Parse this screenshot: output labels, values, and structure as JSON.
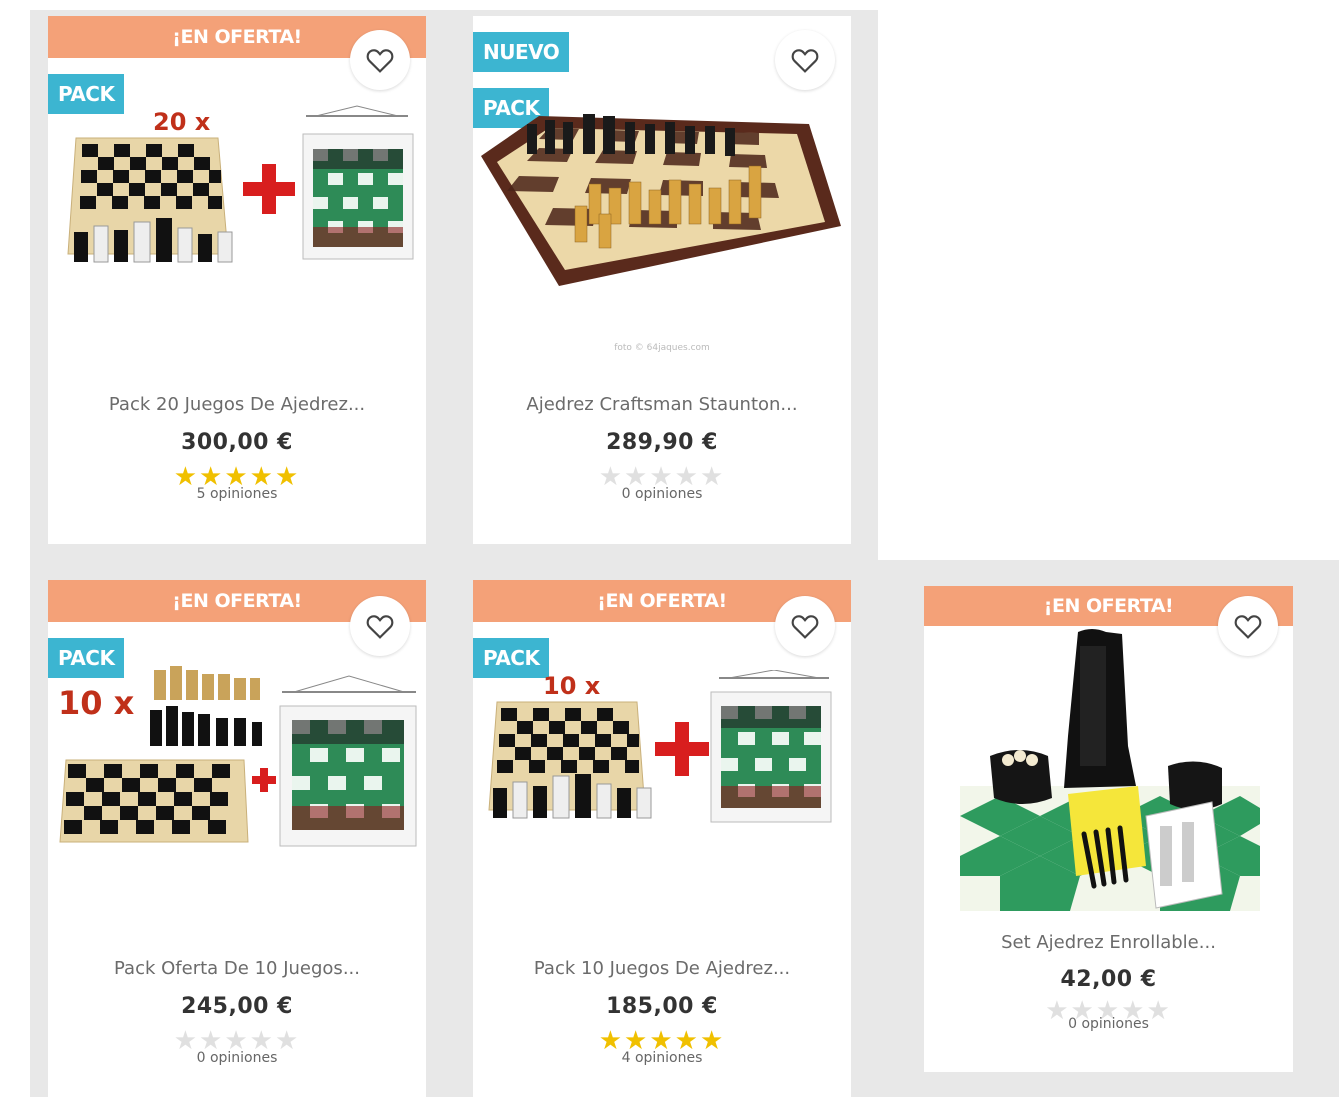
{
  "products": [
    {
      "offer_label": "¡EN OFERTA!",
      "flags": [
        "PACK"
      ],
      "name": "Pack 20 Juegos De Ajedrez...",
      "price": "300,00 €",
      "rating": 5,
      "reviews": "5 opiniones",
      "image_text": "20 x"
    },
    {
      "offer_label": "",
      "flags": [
        "NUEVO",
        "PACK"
      ],
      "name": "Ajedrez Craftsman Staunton...",
      "price": "289,90 €",
      "rating": 0,
      "reviews": "0 opiniones",
      "image_text": "foto © 64jaques.com"
    },
    {
      "offer_label": "¡EN OFERTA!",
      "flags": [
        "PACK"
      ],
      "name": "Pack Oferta De 10 Juegos...",
      "price": "245,00 €",
      "rating": 0,
      "reviews": "0 opiniones",
      "image_text": "10 x"
    },
    {
      "offer_label": "¡EN OFERTA!",
      "flags": [
        "PACK"
      ],
      "name": "Pack 10 Juegos De Ajedrez...",
      "price": "185,00 €",
      "rating": 5,
      "reviews": "4 opiniones",
      "image_text": "10 x"
    },
    {
      "offer_label": "¡EN OFERTA!",
      "flags": [],
      "name": "Set Ajedrez Enrollable...",
      "price": "42,00 €",
      "rating": 0,
      "reviews": "0 opiniones",
      "image_text": ""
    }
  ],
  "icons": {
    "wishlist": "heart-outline-icon",
    "rating": "star-icon"
  },
  "colors": {
    "offer": "#f4a178",
    "flag": "#3cb5d1",
    "star": "#f0c000",
    "star_empty": "#e0e0e0"
  }
}
